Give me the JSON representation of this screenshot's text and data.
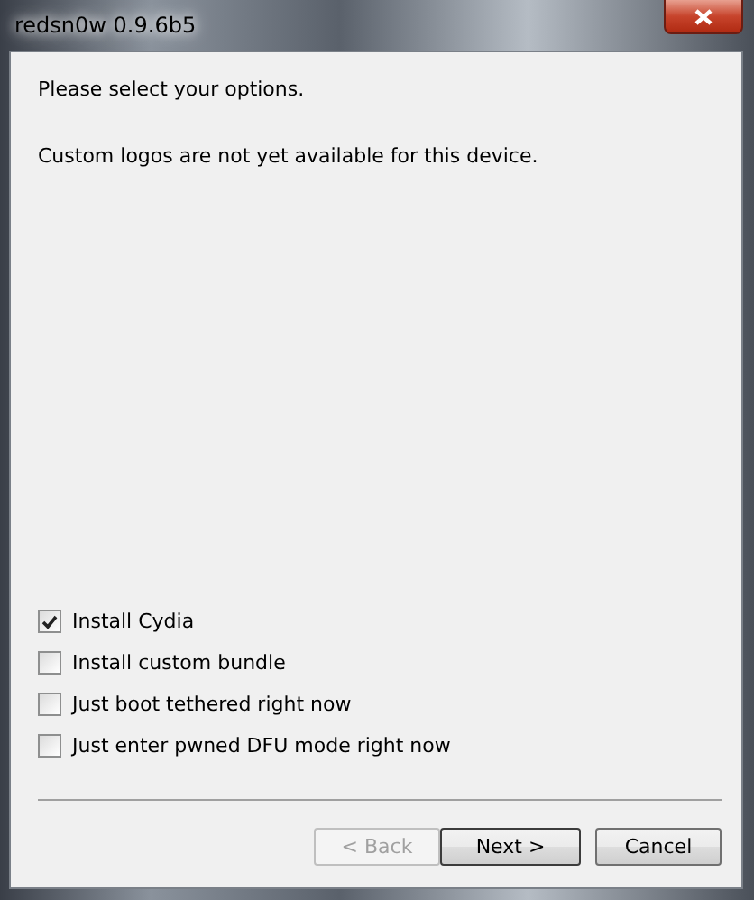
{
  "window": {
    "title": "redsn0w 0.9.6b5"
  },
  "messages": [
    "Please select your options.",
    "Custom logos are not yet available for this device."
  ],
  "options": [
    {
      "label": "Install Cydia",
      "checked": true
    },
    {
      "label": "Install custom bundle",
      "checked": false
    },
    {
      "label": "Just boot tethered right now",
      "checked": false
    },
    {
      "label": "Just enter pwned DFU mode right now",
      "checked": false
    }
  ],
  "buttons": [
    {
      "label": "< Back",
      "disabled": true,
      "default": false
    },
    {
      "label": "Next >",
      "disabled": false,
      "default": true
    },
    {
      "label": "Cancel",
      "disabled": false,
      "default": false
    }
  ]
}
